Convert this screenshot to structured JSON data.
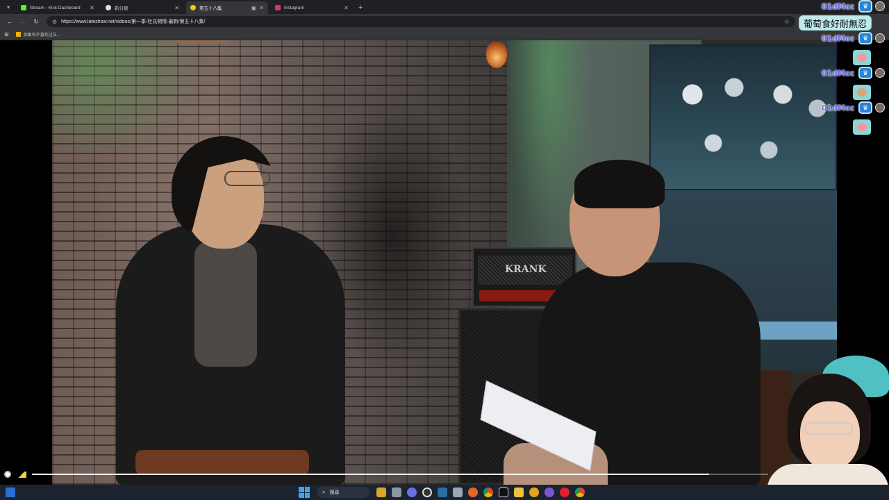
{
  "browser": {
    "tabs": [
      {
        "title": "Stream - Kick Dashboard",
        "favicon_color": "#53fc18",
        "active": false
      },
      {
        "title": "新分頁",
        "favicon_color": "#e0e0e0",
        "active": false
      },
      {
        "title": "第五十八集",
        "favicon_color": "#f5c518",
        "active": true
      },
      {
        "title": "Instagram",
        "favicon_color": "#e1306c",
        "active": false
      }
    ],
    "url": "https://www.lateshow.net/videos/第一季-杜氏閒情-最新/第五十八集/",
    "bookmark_label": "如果有不喜欢过文…"
  },
  "video": {
    "amp_brand": "KRANK",
    "progress_fraction": 0.92
  },
  "chat": {
    "username": "01dMcc",
    "message": "葡萄食好耐無忍"
  },
  "taskbar": {
    "search_label": "搜尋"
  },
  "colors": {
    "chat_name": "#6a6cf0",
    "chat_bubble_bg": "#bfe9ea",
    "badge_blue": "#2a84d8"
  }
}
